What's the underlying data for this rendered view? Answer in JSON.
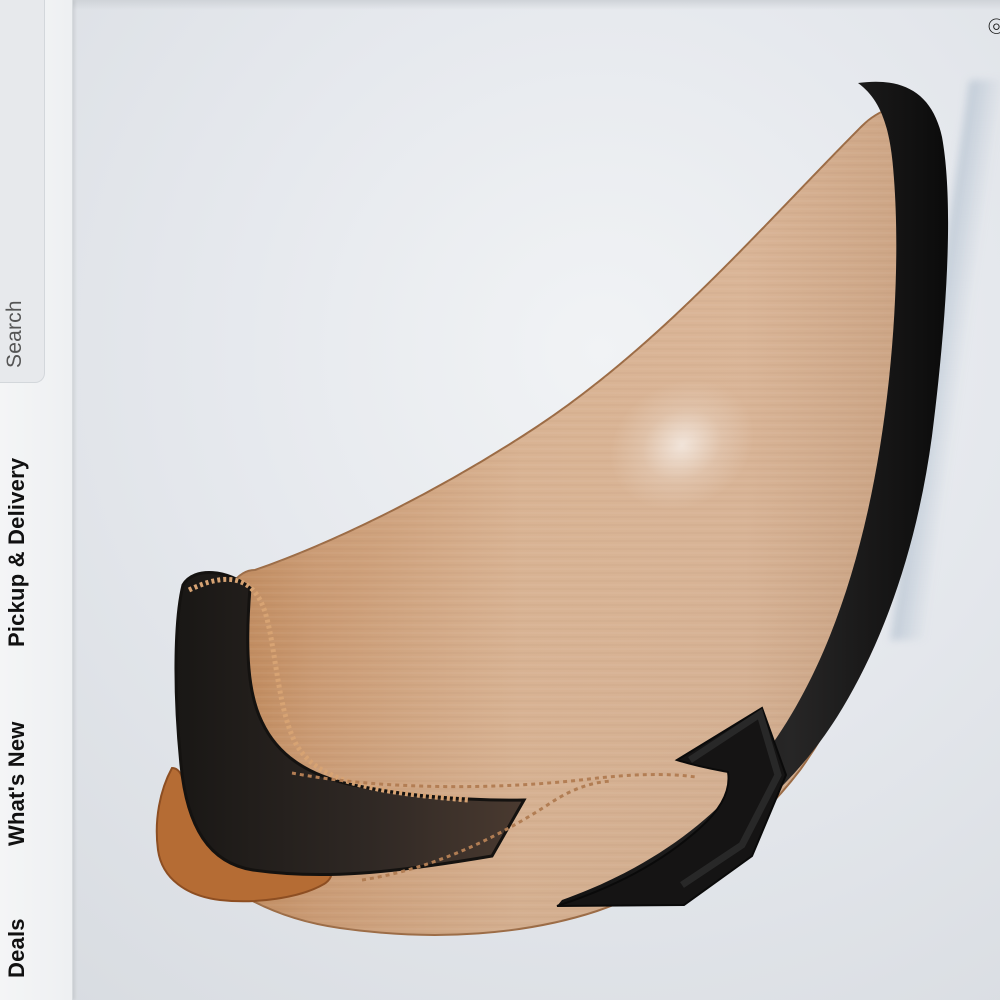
{
  "nav": {
    "search_label": "Search",
    "items": [
      {
        "label": "Pickup & Delivery"
      },
      {
        "label": "What's New"
      },
      {
        "label": "Deals"
      }
    ]
  },
  "icons": {
    "corner": "camera-icon"
  },
  "colors": {
    "rail_background": "#eef0f2",
    "search_background": "#e7e9ec",
    "text_primary": "#111111",
    "text_secondary": "#555555",
    "boot_tan": "#d2aa84",
    "boot_dark": "#1f1d1d"
  }
}
